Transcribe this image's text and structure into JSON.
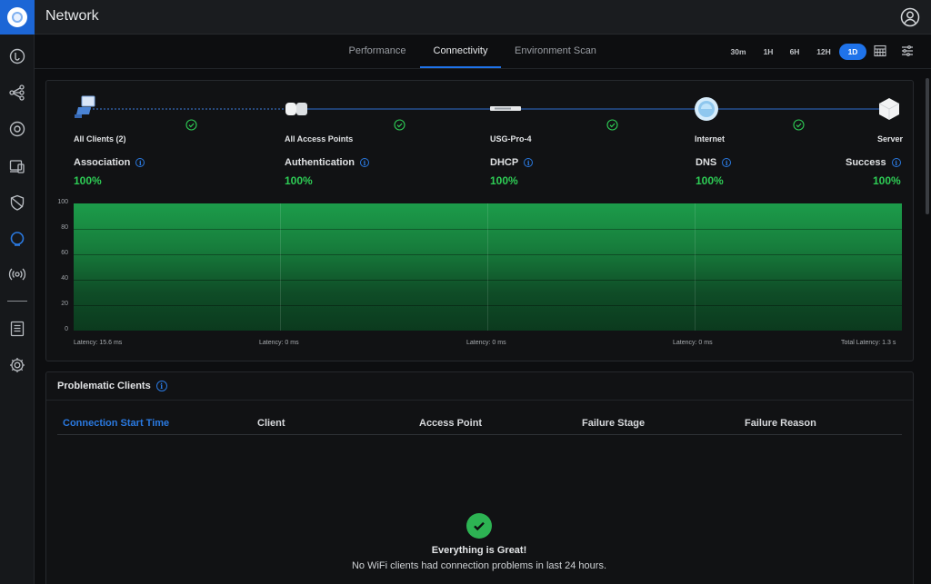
{
  "app": {
    "title": "Network"
  },
  "tabs": [
    {
      "label": "Performance",
      "active": false
    },
    {
      "label": "Connectivity",
      "active": true
    },
    {
      "label": "Environment Scan",
      "active": false
    }
  ],
  "time_ranges": [
    {
      "label": "30m",
      "active": false
    },
    {
      "label": "1H",
      "active": false
    },
    {
      "label": "6H",
      "active": false
    },
    {
      "label": "12H",
      "active": false
    },
    {
      "label": "1D",
      "active": true
    }
  ],
  "toolbar_icons": [
    "calendar-icon",
    "sliders-icon"
  ],
  "sidebar_icons": [
    "dashboard-icon",
    "topology-icon",
    "devices-icon",
    "clients-icon",
    "security-icon",
    "insights-icon",
    "wifi-broadcast-icon",
    "events-icon",
    "settings-icon"
  ],
  "path": {
    "nodes": [
      {
        "name": "All Clients (2)",
        "icon": "laptop-icon"
      },
      {
        "name": "All Access Points",
        "icon": "access-point-icon"
      },
      {
        "name": "USG-Pro-4",
        "icon": "gateway-icon"
      },
      {
        "name": "Internet",
        "icon": "globe-icon"
      },
      {
        "name": "Server",
        "icon": "server-icon"
      }
    ],
    "metrics": [
      {
        "label": "Association",
        "value": "100%"
      },
      {
        "label": "Authentication",
        "value": "100%"
      },
      {
        "label": "DHCP",
        "value": "100%"
      },
      {
        "label": "DNS",
        "value": "100%"
      },
      {
        "label": "Success",
        "value": "100%"
      }
    ],
    "latencies": [
      "Latency: 15.6 ms",
      "Latency: 0 ms",
      "Latency: 0 ms",
      "Latency: 0 ms",
      "Total Latency: 1.3 s"
    ]
  },
  "chart_data": {
    "type": "area",
    "y_ticks": [
      "100",
      "80",
      "60",
      "40",
      "20",
      "0"
    ],
    "ylim": [
      0,
      100
    ],
    "segments": [
      "Association",
      "Authentication",
      "DHCP",
      "DNS"
    ],
    "values": [
      100,
      100,
      100,
      100
    ]
  },
  "colors": {
    "accent": "#1f73ea",
    "success": "#2ecc55",
    "area": "#1c9c4a"
  },
  "problematic_clients": {
    "title": "Problematic Clients",
    "columns": [
      "Connection Start Time",
      "Client",
      "Access Point",
      "Failure Stage",
      "Failure Reason"
    ],
    "rows": [],
    "empty_title": "Everything is Great!",
    "empty_message": "No WiFi clients had connection problems in last 24 hours."
  }
}
